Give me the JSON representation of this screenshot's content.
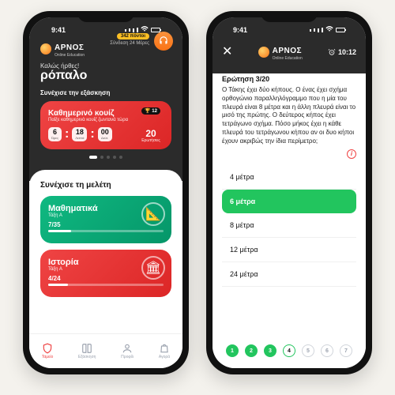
{
  "brand": {
    "name": "ΑΡΝΟΣ",
    "tagline": "Online Education"
  },
  "status": {
    "time": "9:41"
  },
  "home": {
    "greeting": "Καλώς ήρθες!",
    "username": "ρόπαλο",
    "points": "342 πόντοι",
    "login_streak": "Σύνδεση 24 Μέρες",
    "continue_practice": "Συνέχισε την εξάσκηση",
    "quiz": {
      "title": "Καθημερινό κουίζ",
      "subtitle": "Παίξε καθημερινά κουίζ ζωντανά τώρα",
      "timer": {
        "h": "6",
        "h_lbl": "Ώρες",
        "m": "18",
        "m_lbl": "Λεπτά",
        "s": "00",
        "s_lbl": "Δεύτ."
      },
      "badge": "🏆 12",
      "count": "20",
      "count_lbl": "Ερωτήσεις"
    },
    "study_label": "Συνέχισε τη μελέτη",
    "subjects": [
      {
        "name": "Μαθηματικά",
        "class": "Τάξη Α",
        "progress": "7/35",
        "pct": 20,
        "icon": "📐"
      },
      {
        "name": "Ιστορία",
        "class": "Τάξη Α",
        "progress": "4/24",
        "pct": 17,
        "icon": "🏛"
      }
    ],
    "nav": {
      "shield": "Ταμείο",
      "book": "Εξάσκηση",
      "profile": "Προφίλ",
      "store": "Αγορά"
    }
  },
  "quiz": {
    "timer": "10:12",
    "question_no": "Ερώτηση 3/20",
    "question": "Ο Τάκης έχει δύο κήπους. Ο ένας έχει σχήμα ορθογώνιο παραλληλόγραμμο που η μία του πλευρά είναι 8 μέτρα και η άλλη πλευρά είναι το μισό της πρώτης. Ο δεύτερος κήπος έχει τετράγωνο σχήμα. Πόσο μήκος έχει η κάθε πλευρά του τετράγωνου κήπου αν οι δυο κήποι έχουν ακριβώς την ίδια περίμετρο;",
    "answers": [
      "4 μέτρα",
      "6 μέτρα",
      "8 μέτρα",
      "12 μέτρα",
      "24 μέτρα"
    ],
    "selected": 1,
    "progress": {
      "done": [
        1,
        2,
        3
      ],
      "current": 3,
      "shown": [
        1,
        2,
        3,
        4,
        5,
        6,
        7
      ]
    }
  }
}
